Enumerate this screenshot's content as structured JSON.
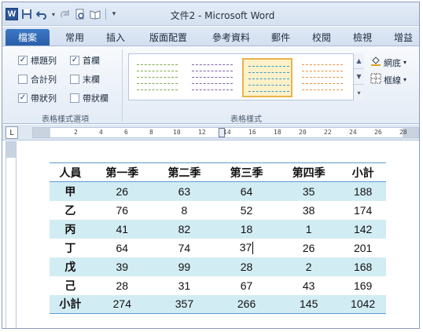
{
  "window": {
    "title": "文件2 - Microsoft Word"
  },
  "qat": {
    "logo": "W",
    "icons": [
      "save-icon",
      "undo-icon",
      "redo-icon",
      "print-preview-icon",
      "open-book-icon",
      "customize-qat-icon"
    ]
  },
  "tabs": [
    "檔案",
    "常用",
    "插入",
    "版面配置",
    "參考資料",
    "郵件",
    "校閱",
    "檢視",
    "增益"
  ],
  "ribbon": {
    "options_group": {
      "label": "表格樣式選項",
      "items": [
        {
          "label": "標題列",
          "checked": true
        },
        {
          "label": "首欄",
          "checked": true
        },
        {
          "label": "合計列",
          "checked": false
        },
        {
          "label": "末欄",
          "checked": false
        },
        {
          "label": "帶狀列",
          "checked": true
        },
        {
          "label": "帶狀欄",
          "checked": false
        }
      ]
    },
    "styles_group": {
      "label": "表格樣式"
    },
    "shading_label": "網底",
    "borders_label": "框線"
  },
  "ruler": {
    "ticks": [
      "2",
      "4",
      "6",
      "8",
      "10",
      "12",
      "14",
      "16",
      "18",
      "20",
      "22",
      "24",
      "26",
      "28"
    ]
  },
  "table": {
    "headers": [
      "人員",
      "第一季",
      "第二季",
      "第三季",
      "第四季",
      "小計"
    ],
    "rows": [
      [
        "甲",
        "26",
        "63",
        "64",
        "35",
        "188"
      ],
      [
        "乙",
        "76",
        "8",
        "52",
        "38",
        "174"
      ],
      [
        "丙",
        "41",
        "82",
        "18",
        "1",
        "142"
      ],
      [
        "丁",
        "64",
        "74",
        "37",
        "26",
        "201"
      ],
      [
        "戊",
        "39",
        "99",
        "28",
        "2",
        "168"
      ],
      [
        "己",
        "28",
        "31",
        "67",
        "43",
        "169"
      ],
      [
        "小計",
        "274",
        "357",
        "266",
        "145",
        "1042"
      ]
    ]
  },
  "colors": {
    "accent": "#5b9bd5",
    "band": "#d2ecf4",
    "file_tab": "#2a5ea8"
  }
}
